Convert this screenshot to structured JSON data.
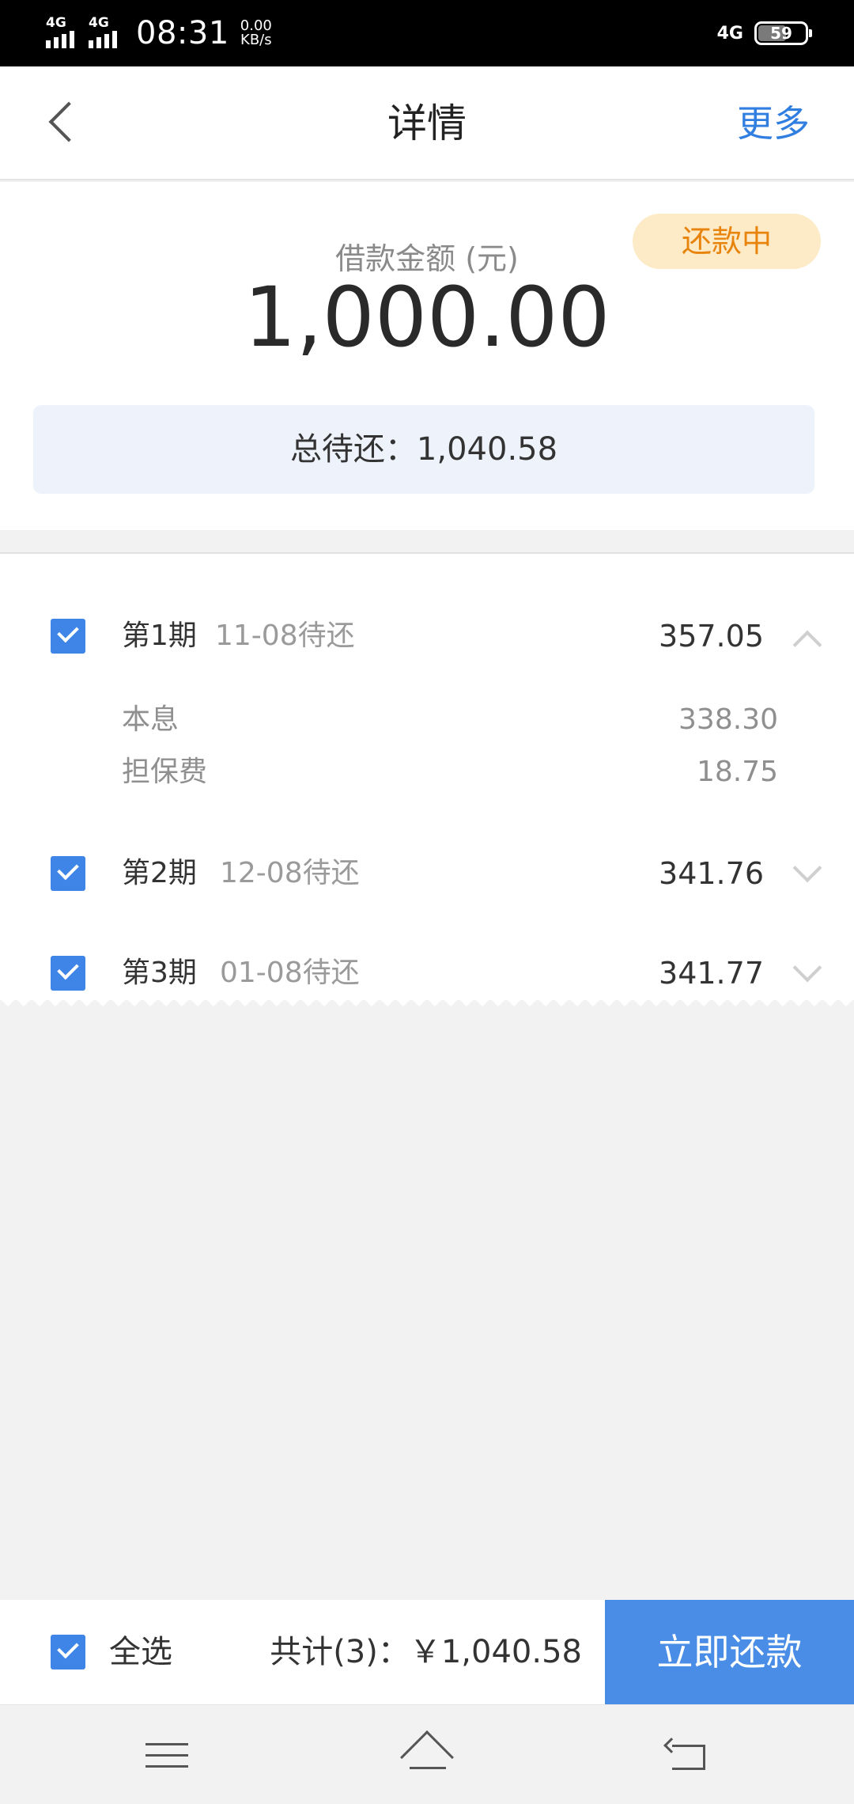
{
  "status_bar": {
    "network1": "4G",
    "network2": "4G",
    "time": "08:31",
    "speed_value": "0.00",
    "speed_unit": "KB/s",
    "network_right": "4G",
    "battery": "59",
    "battery_level": 0.59
  },
  "header": {
    "title": "详情",
    "more": "更多",
    "back_icon": "chevron-left-icon"
  },
  "summary": {
    "status_badge": "还款中",
    "loan_label": "借款金额 (元)",
    "loan_amount": "1,000.00",
    "total_due": "总待还：1,040.58",
    "badge_bg": "#fdebc8",
    "badge_color": "#e8830c"
  },
  "installments": [
    {
      "period": "第1期",
      "date": "11-08待还",
      "amount": "357.05",
      "expanded": true,
      "details": [
        {
          "label": "本息",
          "value": "338.30"
        },
        {
          "label": "担保费",
          "value": "18.75"
        }
      ]
    },
    {
      "period": "第2期",
      "date": "12-08待还",
      "amount": "341.76",
      "expanded": false
    },
    {
      "period": "第3期",
      "date": "01-08待还",
      "amount": "341.77",
      "expanded": false
    }
  ],
  "bottom_bar": {
    "select_all": "全选",
    "total": "共计(3)：￥1,040.58",
    "pay_button": "立即还款",
    "accent": "#4a8de6"
  },
  "nav_bar": {
    "menu_icon": "menu-icon",
    "home_icon": "home-icon",
    "back_icon": "back-icon"
  }
}
